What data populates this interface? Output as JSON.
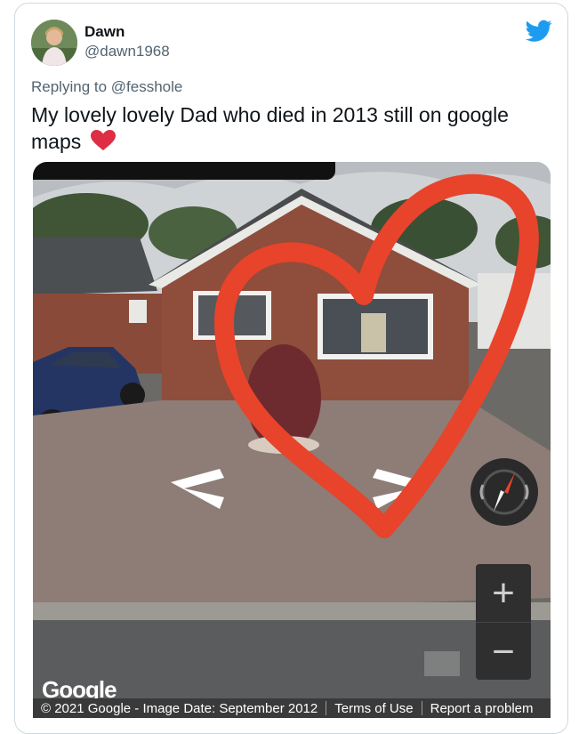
{
  "tweet": {
    "display_name": "Dawn",
    "handle": "@dawn1968",
    "replying_prefix": "Replying to",
    "replying_to": "@fesshole",
    "text": "My lovely lovely Dad who died in 2013 still on google maps",
    "emoji": "red-heart"
  },
  "streetview": {
    "logo": "Google",
    "copyright": "© 2021 Google - Image Date: September 2012",
    "terms": "Terms of Use",
    "report": "Report a problem",
    "zoom_in": "+",
    "zoom_out": "−"
  },
  "colors": {
    "twitter_blue": "#1d9bf0",
    "heart_red": "#e8432b"
  }
}
